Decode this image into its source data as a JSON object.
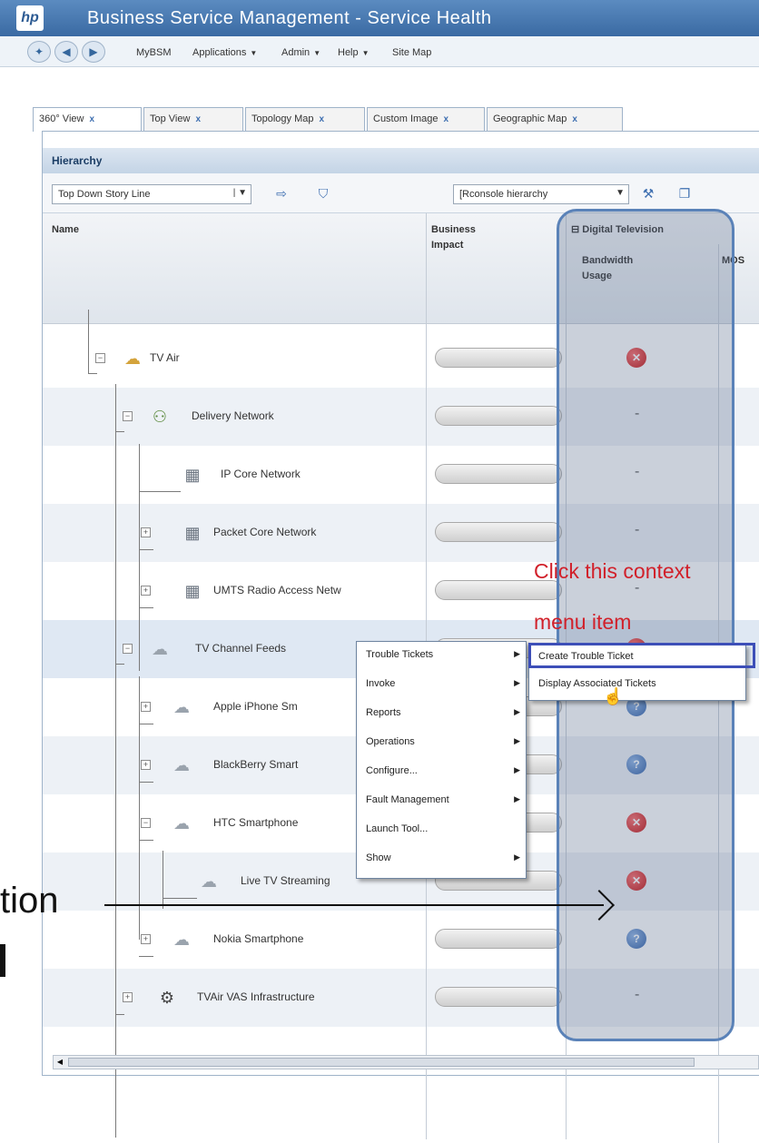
{
  "window": {
    "logo_text": "hp",
    "title": "Business Service Management  - Service Health"
  },
  "menubar": {
    "items": [
      {
        "label": "MyBSM",
        "dropdown": false
      },
      {
        "label": "Applications",
        "dropdown": true
      },
      {
        "label": "Admin",
        "dropdown": true
      },
      {
        "label": "Help",
        "dropdown": true
      },
      {
        "label": "Site Map",
        "dropdown": false
      }
    ]
  },
  "tabs": [
    {
      "label": "360° View",
      "active": true
    },
    {
      "label": "Top View",
      "active": false
    },
    {
      "label": "Topology Map",
      "active": false
    },
    {
      "label": "Custom Image",
      "active": false
    },
    {
      "label": "Geographic Map",
      "active": false
    }
  ],
  "panel": {
    "title": "Hierarchy"
  },
  "toolbar": {
    "view_select": "Top Down Story Line",
    "perspective_select": "[Rconsole hierarchy"
  },
  "columns": {
    "name": "Name",
    "impact": "Business\nImpact",
    "group": "Digital Television",
    "bandwidth": "Bandwidth\nUsage",
    "mos": "MOS"
  },
  "rows": [
    {
      "label": "TV Air",
      "status": "red",
      "icon": "cloud-group-icon"
    },
    {
      "label": "Delivery Network",
      "status": "dash",
      "icon": "network-icon"
    },
    {
      "label": "IP Core Network",
      "status": "dash",
      "icon": "server-icon"
    },
    {
      "label": "Packet Core Network",
      "status": "dash",
      "icon": "server-icon"
    },
    {
      "label": "UMTS Radio Access Netw",
      "status": "dash",
      "icon": "server-icon"
    },
    {
      "label": "TV Channel Feeds",
      "status": "red",
      "icon": "cloud-icon"
    },
    {
      "label": "Apple iPhone Sm",
      "status": "blue",
      "icon": "cloud-icon"
    },
    {
      "label": "BlackBerry Smart",
      "status": "blue",
      "icon": "cloud-icon"
    },
    {
      "label": "HTC Smartphone",
      "status": "red",
      "icon": "cloud-icon"
    },
    {
      "label": "Live TV Streaming",
      "status": "red",
      "icon": "cloud-icon"
    },
    {
      "label": "Nokia Smartphone",
      "status": "blue",
      "icon": "cloud-icon"
    },
    {
      "label": "TVAir VAS Infrastructure",
      "status": "dash",
      "icon": "infrastructure-icon"
    }
  ],
  "context_menu": {
    "items": [
      {
        "label": "Trouble Tickets",
        "submenu": true
      },
      {
        "label": "Invoke",
        "submenu": true
      },
      {
        "label": "Reports",
        "submenu": true
      },
      {
        "label": "Operations",
        "submenu": true
      },
      {
        "label": "Configure...",
        "submenu": true
      },
      {
        "label": "Fault Management",
        "submenu": true
      },
      {
        "label": "Launch Tool...",
        "submenu": false
      },
      {
        "label": "Show",
        "submenu": true
      }
    ]
  },
  "submenu": {
    "items": [
      "Create Trouble Ticket",
      "Display Associated Tickets"
    ]
  },
  "annotation": {
    "line1": "Click this context",
    "line2": "menu item"
  },
  "side_text": {
    "word": "tion"
  },
  "colors": {
    "annotation": "#d1202a",
    "highlight_border": "#3d4fb8",
    "status_red": "#c41010",
    "status_blue": "#2f5fa8"
  }
}
